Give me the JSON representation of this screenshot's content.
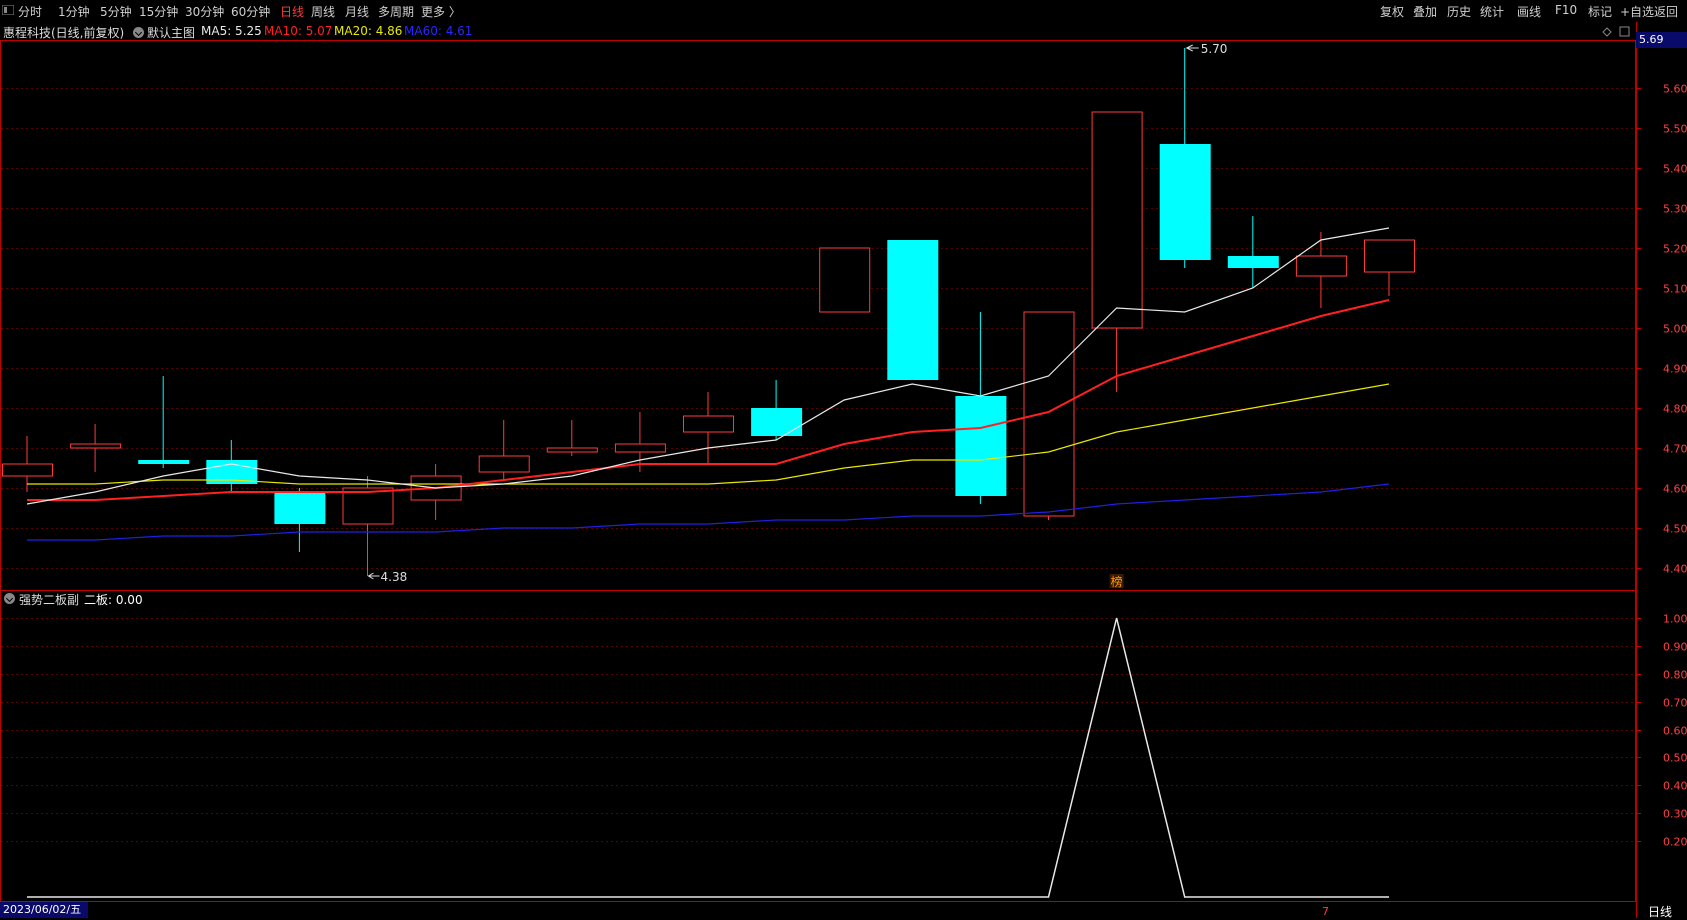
{
  "toolbar": {
    "periods": [
      "分时",
      "1分钟",
      "5分钟",
      "15分钟",
      "30分钟",
      "60分钟",
      "日线",
      "周线",
      "月线",
      "多周期",
      "更多 〉"
    ],
    "active_period": "日线",
    "right_buttons": [
      "复权",
      "叠加",
      "历史",
      "统计",
      "画线",
      "F10",
      "标记",
      "+自选",
      "返回"
    ]
  },
  "title": {
    "stock": "惠程科技(日线,前复权)",
    "template": "默认主图",
    "ma": [
      {
        "label": "MA5: 5.25",
        "color": "#e8e8e8"
      },
      {
        "label": "MA10: 5.07",
        "color": "#ff2020"
      },
      {
        "label": "MA20: 4.86",
        "color": "#e8e800"
      },
      {
        "label": "MA60: 4.61",
        "color": "#2828ff"
      }
    ]
  },
  "price_tag": "5.69",
  "high_label": "5.70",
  "low_label": "4.38",
  "bang_label": "榜",
  "sub_title": {
    "name": "强势二板副",
    "value": "二板: 0.00"
  },
  "date_label": "2023/06/02/五",
  "period_label": "日线",
  "bottom_marker": "7",
  "colors": {
    "up": "#ff3a3a",
    "down": "#00ffff",
    "grid": "#5a0000",
    "border": "#c00000",
    "ma5": "#e8e8e8",
    "ma10": "#ff2020",
    "ma20": "#e8e800",
    "ma60": "#2020e0",
    "axis_text": "#ff4040"
  },
  "chart_data": {
    "type": "candlestick",
    "price_axis": {
      "min": 4.35,
      "max": 5.72,
      "ticks": [
        4.4,
        4.5,
        4.6,
        4.7,
        4.8,
        4.9,
        5.0,
        5.1,
        5.2,
        5.3,
        5.4,
        5.5,
        5.6
      ]
    },
    "candles": [
      {
        "o": 4.63,
        "c": 4.66,
        "h": 4.73,
        "l": 4.59
      },
      {
        "o": 4.7,
        "c": 4.71,
        "h": 4.76,
        "l": 4.64
      },
      {
        "o": 4.67,
        "c": 4.66,
        "h": 4.88,
        "l": 4.65
      },
      {
        "o": 4.67,
        "c": 4.61,
        "h": 4.72,
        "l": 4.59
      },
      {
        "o": 4.59,
        "c": 4.51,
        "h": 4.6,
        "l": 4.44
      },
      {
        "o": 4.51,
        "c": 4.6,
        "h": 4.63,
        "l": 4.38
      },
      {
        "o": 4.57,
        "c": 4.63,
        "h": 4.66,
        "l": 4.52
      },
      {
        "o": 4.64,
        "c": 4.68,
        "h": 4.77,
        "l": 4.62
      },
      {
        "o": 4.69,
        "c": 4.7,
        "h": 4.77,
        "l": 4.68
      },
      {
        "o": 4.69,
        "c": 4.71,
        "h": 4.79,
        "l": 4.64
      },
      {
        "o": 4.74,
        "c": 4.78,
        "h": 4.84,
        "l": 4.66
      },
      {
        "o": 4.8,
        "c": 4.73,
        "h": 4.87,
        "l": 4.72
      },
      {
        "o": 5.04,
        "c": 5.2,
        "h": 5.2,
        "l": 5.04
      },
      {
        "o": 5.22,
        "c": 4.87,
        "h": 5.22,
        "l": 4.87
      },
      {
        "o": 4.83,
        "c": 4.58,
        "h": 5.04,
        "l": 4.56
      },
      {
        "o": 4.53,
        "c": 5.04,
        "h": 5.04,
        "l": 4.52
      },
      {
        "o": 5.0,
        "c": 5.54,
        "h": 5.54,
        "l": 4.84
      },
      {
        "o": 5.46,
        "c": 5.17,
        "h": 5.7,
        "l": 5.15
      },
      {
        "o": 5.18,
        "c": 5.15,
        "h": 5.28,
        "l": 5.1
      },
      {
        "o": 5.13,
        "c": 5.18,
        "h": 5.24,
        "l": 5.05
      },
      {
        "o": 5.14,
        "c": 5.22,
        "h": 5.22,
        "l": 5.08
      }
    ],
    "ma5": [
      4.56,
      4.59,
      4.63,
      4.66,
      4.63,
      4.62,
      4.6,
      4.61,
      4.63,
      4.67,
      4.7,
      4.72,
      4.82,
      4.86,
      4.83,
      4.88,
      5.05,
      5.04,
      5.1,
      5.22,
      5.25
    ],
    "ma10": [
      4.57,
      4.57,
      4.58,
      4.59,
      4.59,
      4.59,
      4.6,
      4.62,
      4.64,
      4.66,
      4.66,
      4.66,
      4.71,
      4.74,
      4.75,
      4.79,
      4.88,
      4.93,
      4.98,
      5.03,
      5.07
    ],
    "ma20": [
      4.61,
      4.61,
      4.62,
      4.62,
      4.61,
      4.61,
      4.61,
      4.61,
      4.61,
      4.61,
      4.61,
      4.62,
      4.65,
      4.67,
      4.67,
      4.69,
      4.74,
      4.77,
      4.8,
      4.83,
      4.86
    ],
    "ma60": [
      4.47,
      4.47,
      4.48,
      4.48,
      4.49,
      4.49,
      4.49,
      4.5,
      4.5,
      4.51,
      4.51,
      4.52,
      4.52,
      4.53,
      4.53,
      4.54,
      4.56,
      4.57,
      4.58,
      4.59,
      4.61
    ],
    "indicator": {
      "name": "二板",
      "axis": {
        "min": 0.0,
        "max": 1.05,
        "ticks": [
          0.2,
          0.3,
          0.4,
          0.5,
          0.6,
          0.7,
          0.8,
          0.9,
          1.0
        ]
      },
      "values": [
        0,
        0,
        0,
        0,
        0,
        0,
        0,
        0,
        0,
        0,
        0,
        0,
        0,
        0,
        0,
        0,
        1,
        0,
        0,
        0,
        0
      ]
    }
  }
}
